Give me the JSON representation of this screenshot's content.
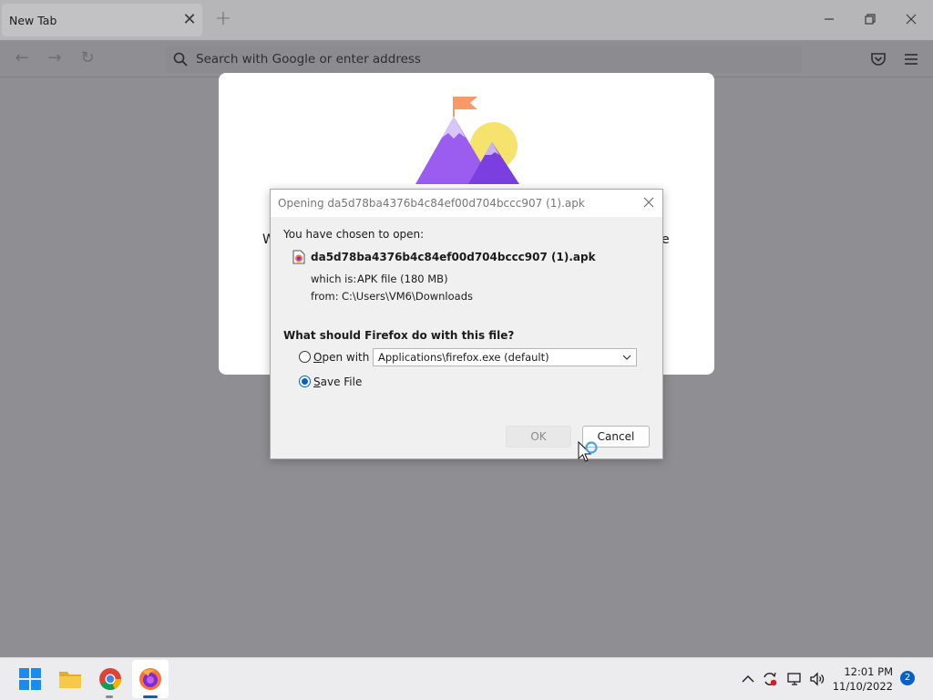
{
  "browser": {
    "tab": {
      "title": "New Tab",
      "close_glyph": "✕"
    },
    "new_tab_glyph": "+",
    "window_controls": {
      "minimize": "—",
      "restore": "❐",
      "close": "✕"
    },
    "nav": {
      "back": "←",
      "forward": "→",
      "reload": "↻"
    },
    "urlbar": {
      "placeholder": "Search with Google or enter address",
      "value": ""
    },
    "icons": [
      "search-icon",
      "pocket-icon",
      "hamburger-menu-icon"
    ]
  },
  "background_page": {
    "partial_left_text": "W",
    "partial_right_text": "e"
  },
  "dialog": {
    "title": "Opening da5d78ba4376b4c84ef00d704bccc907 (1).apk",
    "close_glyph": "✕",
    "chosen_label": "You have chosen to open:",
    "file_name": "da5d78ba4376b4c84ef00d704bccc907 (1).apk",
    "which_label": "which is:",
    "which_value": "APK file (180 MB)",
    "from_label": "from:",
    "from_value": "C:\\Users\\VM6\\Downloads",
    "question": "What should Firefox do with this file?",
    "open_with": {
      "access_key": "O",
      "rest": "pen with",
      "checked": false
    },
    "open_with_app": "Applications\\firefox.exe (default)",
    "save_file": {
      "access_key": "S",
      "rest": "ave File",
      "checked": true
    },
    "ok_label": "OK",
    "ok_enabled": false,
    "cancel_label": "Cancel"
  },
  "taskbar": {
    "apps": [
      "windows-start",
      "file-explorer",
      "google-chrome",
      "firefox"
    ],
    "active_app": "firefox",
    "tray_icons": [
      "chevron-up-icon",
      "sync-icon",
      "network-icon",
      "volume-icon"
    ],
    "time": "12:01 PM",
    "date": "11/10/2022",
    "notification_count": "2"
  },
  "colors": {
    "accent": "#0a5fc4",
    "firefox_orange": "#ff7139",
    "illustration_purple": "#9b5cf0",
    "illustration_sun": "#f6e36d",
    "flag": "#f79a6a"
  }
}
